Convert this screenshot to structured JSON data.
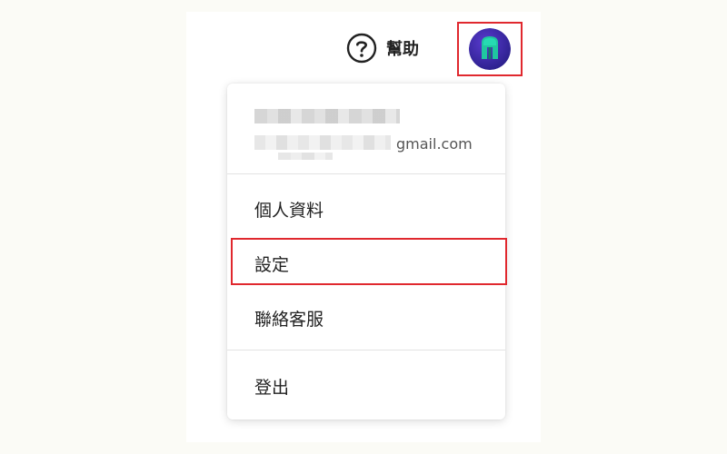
{
  "header": {
    "help_label": "幫助",
    "help_icon": "question-circle-icon",
    "avatar_icon": "helmet-avatar-icon"
  },
  "menu": {
    "email_suffix": "gmail.com",
    "items": [
      {
        "label": "個人資料"
      },
      {
        "label": "設定"
      },
      {
        "label": "聯絡客服"
      }
    ],
    "logout_label": "登出"
  },
  "colors": {
    "highlight": "#e0282e",
    "avatar_bg": "#3a2a9e",
    "avatar_helmet": "#1fc7a0"
  }
}
